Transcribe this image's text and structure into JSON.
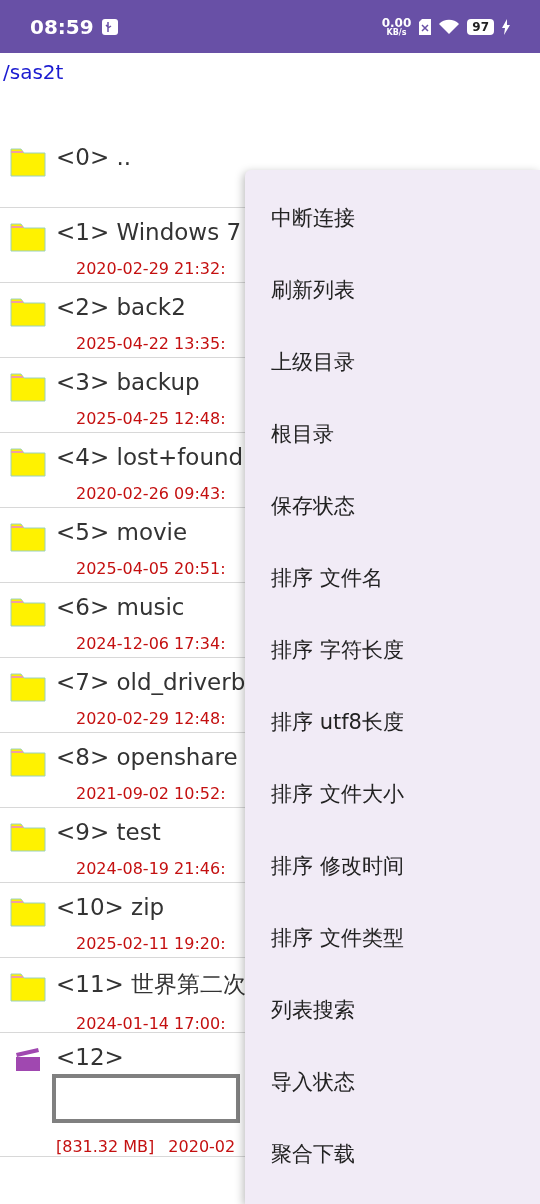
{
  "status_bar": {
    "time": "08:59",
    "speed": "0.00",
    "speed_unit": "KB/s",
    "battery": "97"
  },
  "path": "/sas2t",
  "files": [
    {
      "kind": "folder",
      "name": "<0> .."
    },
    {
      "kind": "folder",
      "name": "<1> Windows 7",
      "date": "2020-02-29 21:32:"
    },
    {
      "kind": "folder",
      "name": "<2> back2",
      "date": "2025-04-22 13:35:"
    },
    {
      "kind": "folder",
      "name": "<3> backup",
      "date": "2025-04-25 12:48:"
    },
    {
      "kind": "folder",
      "name": "<4> lost+found",
      "date": "2020-02-26 09:43:"
    },
    {
      "kind": "folder",
      "name": "<5> movie",
      "date": "2025-04-05 20:51:"
    },
    {
      "kind": "folder",
      "name": "<6> music",
      "date": "2024-12-06 17:34:"
    },
    {
      "kind": "folder",
      "name": "<7> old_driverb",
      "date": "2020-02-29 12:48:"
    },
    {
      "kind": "folder",
      "name": "<8> openshare",
      "date": "2021-09-02 10:52:"
    },
    {
      "kind": "folder",
      "name": "<9> test",
      "date": "2024-08-19 21:46:"
    },
    {
      "kind": "folder",
      "name": "<10> zip",
      "date": "2025-02-11 19:20:"
    },
    {
      "kind": "folder",
      "name": "<11> 世界第二次",
      "date": "2024-01-14 17:00:"
    },
    {
      "kind": "video",
      "name": "<12>",
      "size": "[831.32 MB]",
      "date": "2020-02"
    }
  ],
  "menu": [
    "中断连接",
    "刷新列表",
    "上级目录",
    "根目录",
    "保存状态",
    "排序 文件名",
    "排序 字符长度",
    "排序 utf8长度",
    "排序 文件大小",
    "排序 修改时间",
    "排序 文件类型",
    "列表搜索",
    "导入状态",
    "聚合下载"
  ]
}
